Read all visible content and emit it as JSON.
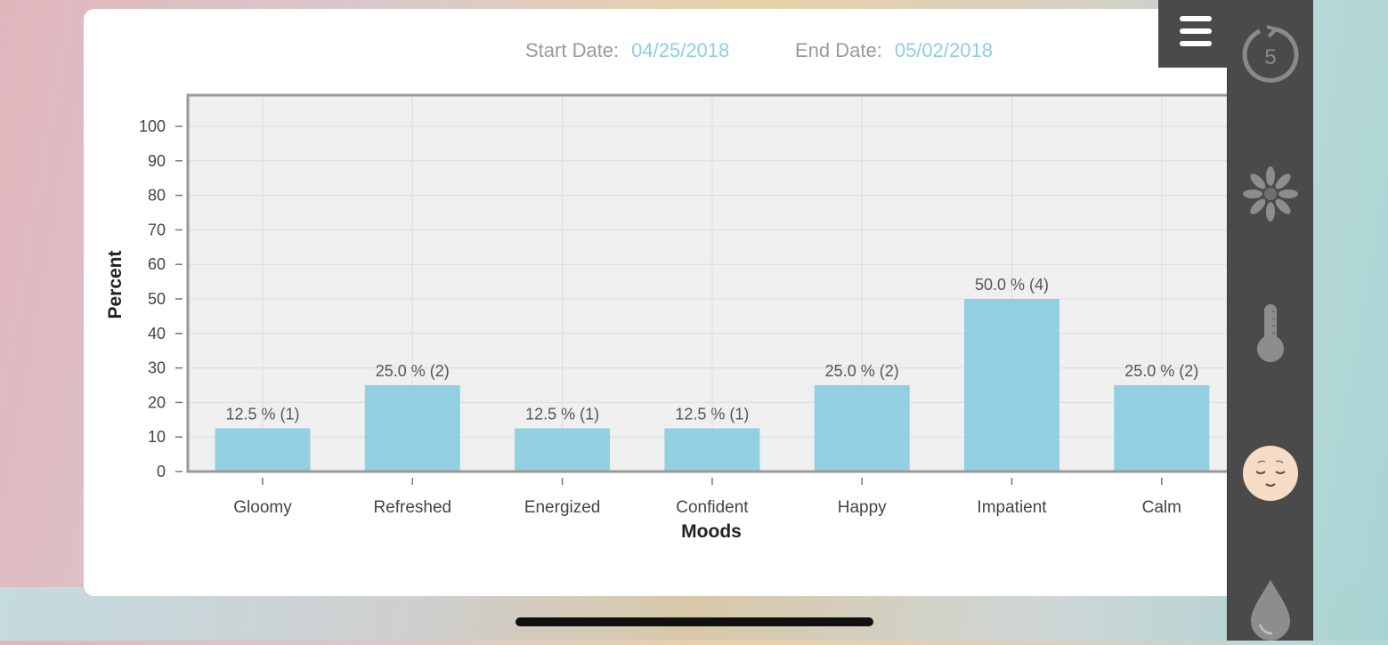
{
  "header": {
    "start_label": "Start Date:",
    "start_value": "04/25/2018",
    "end_label": "End Date:",
    "end_value": "05/02/2018"
  },
  "side_rail": {
    "timer_number": "5",
    "icons": [
      "timer-icon",
      "flower-icon",
      "thermometer-icon",
      "mood-face-icon",
      "water-drop-icon"
    ]
  },
  "menu": {
    "icon": "hamburger-menu-icon"
  },
  "colors": {
    "bar": "#92cfe1",
    "accent_date": "#8ccfe0",
    "rail": "#4a4a4a",
    "plot_bg": "#efeff0"
  },
  "chart_data": {
    "type": "bar",
    "categories": [
      "Gloomy",
      "Refreshed",
      "Energized",
      "Confident",
      "Happy",
      "Impatient",
      "Calm"
    ],
    "values": [
      12.5,
      25.0,
      12.5,
      12.5,
      25.0,
      50.0,
      25.0
    ],
    "data_labels": [
      "12.5 % (1)",
      "25.0 % (2)",
      "12.5 % (1)",
      "12.5 % (1)",
      "25.0 % (2)",
      "50.0 % (4)",
      "25.0 % (2)"
    ],
    "xlabel": "Moods",
    "ylabel": "Percent",
    "ylim": [
      0,
      100
    ],
    "yticks": [
      0,
      10,
      20,
      30,
      40,
      50,
      60,
      70,
      80,
      90,
      100
    ],
    "grid": true
  }
}
